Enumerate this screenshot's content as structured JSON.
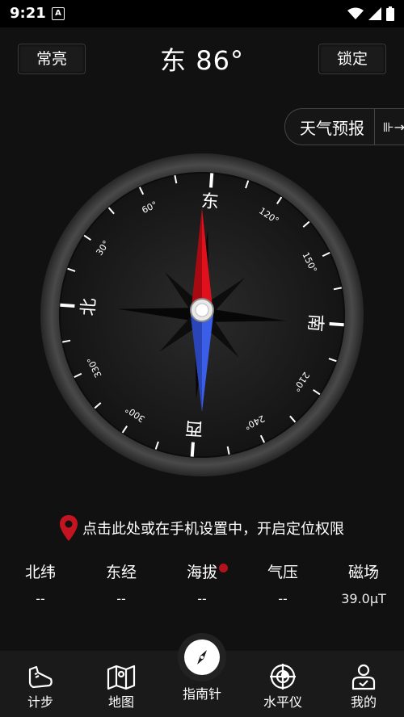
{
  "status": {
    "time": "9:21",
    "notif": "A"
  },
  "header": {
    "keep_on_label": "常亮",
    "heading": "东 86°",
    "lock_label": "锁定"
  },
  "weather": {
    "label": "天气预报",
    "arrow": "⊪→"
  },
  "compass": {
    "heading_degrees": 86,
    "cardinal": {
      "north": "北",
      "east": "东",
      "south": "南",
      "west": "西"
    },
    "degree_labels": [
      "30°",
      "60°",
      "120°",
      "150°",
      "210°",
      "240°",
      "300°",
      "330°"
    ],
    "colors": {
      "needle_north": "#e0101c",
      "needle_south": "#3a5ee8",
      "bezel": "#3a3a3a",
      "dial": "#1c1c1c"
    }
  },
  "location": {
    "prompt": "点击此处或在手机设置中，开启定位权限",
    "pin_color": "#c4141f"
  },
  "stats": [
    {
      "label": "北纬",
      "value": "--"
    },
    {
      "label": "东经",
      "value": "--"
    },
    {
      "label": "海拔",
      "value": "--"
    },
    {
      "label": "气压",
      "value": "--"
    },
    {
      "label": "磁场",
      "value": "39.0μT"
    }
  ],
  "nav": [
    {
      "label": "计步",
      "icon": "shoe-icon"
    },
    {
      "label": "地图",
      "icon": "map-icon"
    },
    {
      "label": "指南针",
      "icon": "compass-icon"
    },
    {
      "label": "水平仪",
      "icon": "level-icon"
    },
    {
      "label": "我的",
      "icon": "profile-icon"
    }
  ]
}
